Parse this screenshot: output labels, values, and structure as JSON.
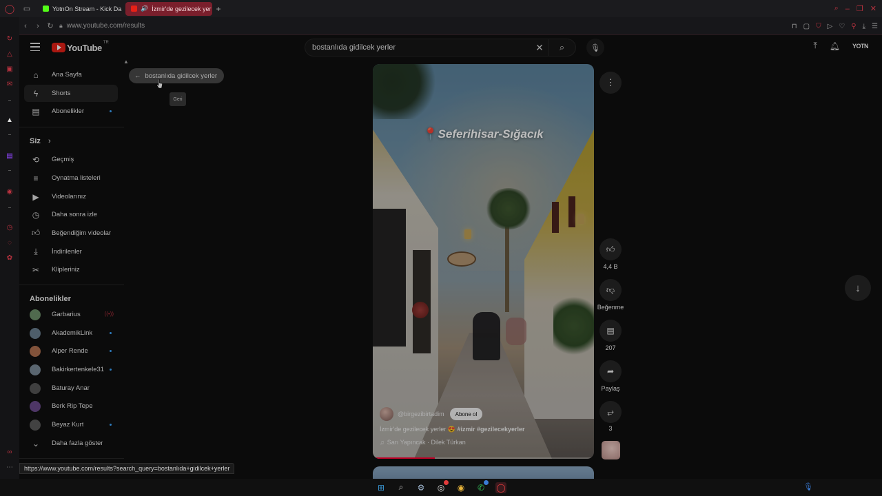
{
  "browser": {
    "tabs": [
      {
        "title": "YotnOn Stream - Kick Da",
        "favicon_color": "#53fc18"
      },
      {
        "title": "İzmir'de gezilecek yer",
        "favicon_color": "#e62117",
        "active": true
      }
    ],
    "url": "www.youtube.com/results",
    "status_url": "https://www.youtube.com/results?search_query=bostanlıda+gidilcek+yerler",
    "accent_color": "#b8323f"
  },
  "header": {
    "logo_text": "YouTube",
    "logo_tm": "TR",
    "search_value": "bostanlıda gidilcek yerler",
    "avatar_text": "YOTN"
  },
  "guide": {
    "main": [
      {
        "label": "Ana Sayfa",
        "icon": "home-icon"
      },
      {
        "label": "Shorts",
        "icon": "shorts-icon",
        "active": true
      },
      {
        "label": "Abonelikler",
        "icon": "subscriptions-icon",
        "dot": true
      }
    ],
    "you_header": "Siz",
    "you": [
      {
        "label": "Geçmiş",
        "icon": "history-icon"
      },
      {
        "label": "Oynatma listeleri",
        "icon": "playlists-icon"
      },
      {
        "label": "Videolarınız",
        "icon": "your-videos-icon"
      },
      {
        "label": "Daha sonra izle",
        "icon": "watch-later-icon"
      },
      {
        "label": "Beğendiğim videolar",
        "icon": "liked-icon"
      },
      {
        "label": "İndirilenler",
        "icon": "download-icon"
      },
      {
        "label": "Klipleriniz",
        "icon": "clips-icon"
      }
    ],
    "subs_header": "Abonelikler",
    "subs": [
      {
        "label": "Garbarius",
        "live": true,
        "color": "#6d8f6a"
      },
      {
        "label": "AkademikLink",
        "dot": true,
        "color": "#6a7f8f"
      },
      {
        "label": "Alper Rende",
        "dot": true,
        "color": "#b07050"
      },
      {
        "label": "Bakirkertenkele31",
        "dot": true,
        "color": "#7a8a98"
      },
      {
        "label": "Baturay Anar",
        "color": "#555555"
      },
      {
        "label": "Berk Rip Tepe",
        "color": "#6a4a8a"
      },
      {
        "label": "Beyaz Kurt",
        "dot": true,
        "color": "#5a5a5a"
      }
    ],
    "show_more": "Daha fazla göster"
  },
  "back_chip": "bostanlıda gidilcek yerler",
  "tooltip": "Geri",
  "short": {
    "overlay_title": "Seferihisar-Sığacık",
    "channel": "@birgezibirtadim",
    "subscribe": "Abone ol",
    "caption_text": "İzmir'de gezilecek yerler 😍",
    "caption_tags": "#izmir #gezilecekyerler",
    "music": "Sarı Yapıncak · Dilek Türkan",
    "progress": 0.28
  },
  "actions": {
    "likes": "4,4 B",
    "dislike": "Beğenme",
    "comments": "207",
    "share": "Paylaş",
    "remix": "3"
  }
}
